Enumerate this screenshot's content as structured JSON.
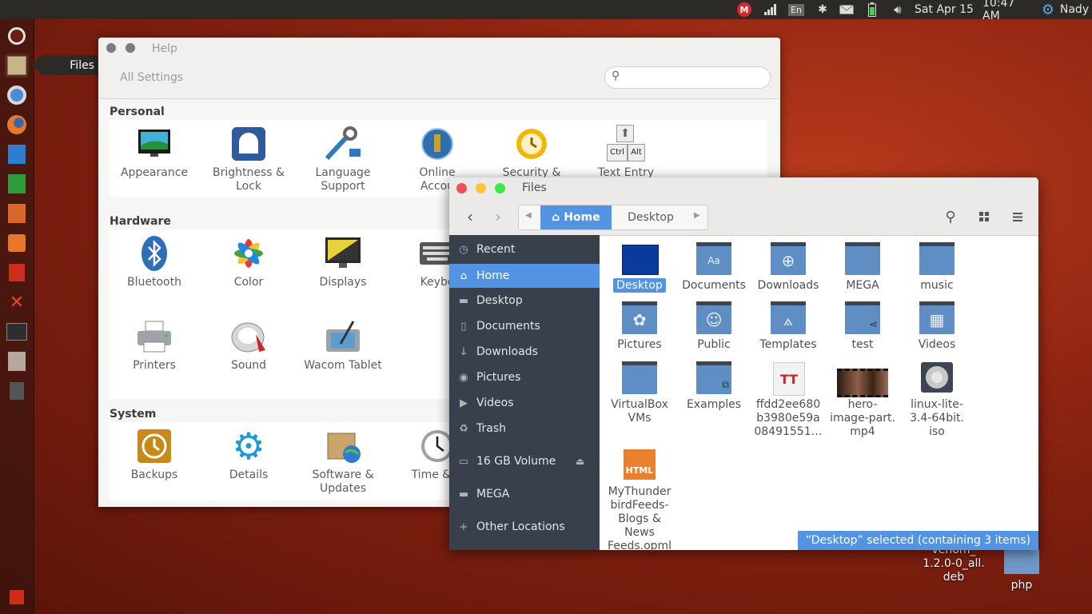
{
  "topbar": {
    "date": "Sat Apr 15",
    "time": "10:47 AM",
    "user": "Nady",
    "keyboard": "En",
    "mega_letter": "M",
    "icons": [
      "mega-icon",
      "signal-icon",
      "keyboard-layout-icon",
      "bluetooth-icon",
      "mail-icon",
      "battery-icon",
      "volume-icon",
      "gear-icon"
    ]
  },
  "launcher": {
    "tooltip": "Files",
    "items": [
      {
        "name": "ubuntu-dash",
        "color": "#e05a2a"
      },
      {
        "name": "files",
        "color": "#c8b48a"
      },
      {
        "name": "chromium",
        "color": "#4a8ad6"
      },
      {
        "name": "firefox",
        "color": "#e8762b"
      },
      {
        "name": "writer",
        "color": "#2f7dd1"
      },
      {
        "name": "calc",
        "color": "#2e9b3d"
      },
      {
        "name": "impress",
        "color": "#d9692a"
      },
      {
        "name": "software-center",
        "color": "#e8762b"
      },
      {
        "name": "trash",
        "color": "#cc2e1c"
      },
      {
        "name": "system-tools",
        "color": "#d83a22"
      },
      {
        "name": "terminal",
        "color": "#2e2e2e"
      },
      {
        "name": "system-monitor",
        "color": "#b7a7a0"
      },
      {
        "name": "usb-device",
        "color": "#555555"
      }
    ]
  },
  "settings": {
    "title": "Help",
    "all_settings": "All Settings",
    "sections": {
      "personal": "Personal",
      "hardware": "Hardware",
      "system": "System"
    },
    "personal_items": [
      {
        "l1": "Appearance",
        "l2": ""
      },
      {
        "l1": "Brightness &",
        "l2": "Lock"
      },
      {
        "l1": "Language",
        "l2": "Support"
      },
      {
        "l1": "Online",
        "l2": "Accou"
      },
      {
        "l1": "Security &",
        "l2": ""
      },
      {
        "l1": "Text Entry",
        "l2": ""
      }
    ],
    "hardware_items": [
      {
        "l1": "Bluetooth",
        "l2": ""
      },
      {
        "l1": "Color",
        "l2": ""
      },
      {
        "l1": "Displays",
        "l2": ""
      },
      {
        "l1": "Keybo",
        "l2": ""
      },
      {
        "l1": "Printers",
        "l2": ""
      },
      {
        "l1": "Sound",
        "l2": ""
      },
      {
        "l1": "Wacom Tablet",
        "l2": ""
      }
    ],
    "system_items": [
      {
        "l1": "Backups",
        "l2": ""
      },
      {
        "l1": "Details",
        "l2": ""
      },
      {
        "l1": "Software &",
        "l2": "Updates"
      },
      {
        "l1": "Time & D",
        "l2": ""
      }
    ],
    "text_entry_keys": [
      "Ctrl",
      "Alt"
    ]
  },
  "files": {
    "title": "Files",
    "crumb_home": "Home",
    "crumb_desktop": "Desktop",
    "sidebar": [
      {
        "label": "Recent",
        "icon": "clock-icon"
      },
      {
        "label": "Home",
        "icon": "home-icon"
      },
      {
        "label": "Desktop",
        "icon": "folder-icon"
      },
      {
        "label": "Documents",
        "icon": "document-icon"
      },
      {
        "label": "Downloads",
        "icon": "download-icon"
      },
      {
        "label": "Pictures",
        "icon": "camera-icon"
      },
      {
        "label": "Videos",
        "icon": "video-icon"
      },
      {
        "label": "Trash",
        "icon": "trash-icon"
      },
      {
        "label": "16 GB Volume",
        "icon": "drive-icon"
      },
      {
        "label": "MEGA",
        "icon": "folder-icon"
      },
      {
        "label": "Other Locations",
        "icon": "plus-icon"
      }
    ],
    "items": [
      {
        "l1": "Desktop",
        "l2": "",
        "l3": "",
        "l4": "",
        "l5": ""
      },
      {
        "l1": "Documents",
        "l2": "",
        "l3": "",
        "l4": "",
        "l5": ""
      },
      {
        "l1": "Downloads",
        "l2": "",
        "l3": "",
        "l4": "",
        "l5": ""
      },
      {
        "l1": "MEGA",
        "l2": "",
        "l3": "",
        "l4": "",
        "l5": ""
      },
      {
        "l1": "music",
        "l2": "",
        "l3": "",
        "l4": "",
        "l5": ""
      },
      {
        "l1": "Pictures",
        "l2": "",
        "l3": "",
        "l4": "",
        "l5": ""
      },
      {
        "l1": "Public",
        "l2": "",
        "l3": "",
        "l4": "",
        "l5": ""
      },
      {
        "l1": "Templates",
        "l2": "",
        "l3": "",
        "l4": "",
        "l5": ""
      },
      {
        "l1": "test",
        "l2": "",
        "l3": "",
        "l4": "",
        "l5": ""
      },
      {
        "l1": "Videos",
        "l2": "",
        "l3": "",
        "l4": "",
        "l5": ""
      },
      {
        "l1": "VirtualBox",
        "l2": "VMs",
        "l3": "",
        "l4": "",
        "l5": ""
      },
      {
        "l1": "Examples",
        "l2": "",
        "l3": "",
        "l4": "",
        "l5": ""
      },
      {
        "l1": "ffdd2ee680",
        "l2": "b3980e59a",
        "l3": "08491551…",
        "l4": "",
        "l5": ""
      },
      {
        "l1": "hero-",
        "l2": "image-part.",
        "l3": "mp4",
        "l4": "",
        "l5": ""
      },
      {
        "l1": "linux-lite-",
        "l2": "3.4-64bit.",
        "l3": "iso",
        "l4": "",
        "l5": ""
      },
      {
        "l1": "MyThunder",
        "l2": "birdFeeds-",
        "l3": "Blogs &",
        "l4": "News",
        "l5": "Feeds.opml"
      }
    ],
    "doc_glyph": "Aa",
    "font_glyph": "TT",
    "html_badge": "HTML",
    "status": "“Desktop” selected  (containing 3 items)"
  },
  "desktop": {
    "deb_l1": "venom_",
    "deb_l2": "1.2.0-0_all.",
    "deb_l3": "deb",
    "php": "php"
  },
  "colors": {
    "accent": "#5294e2",
    "sidebar": "#393f4b",
    "folder": "#5e8ec4"
  }
}
